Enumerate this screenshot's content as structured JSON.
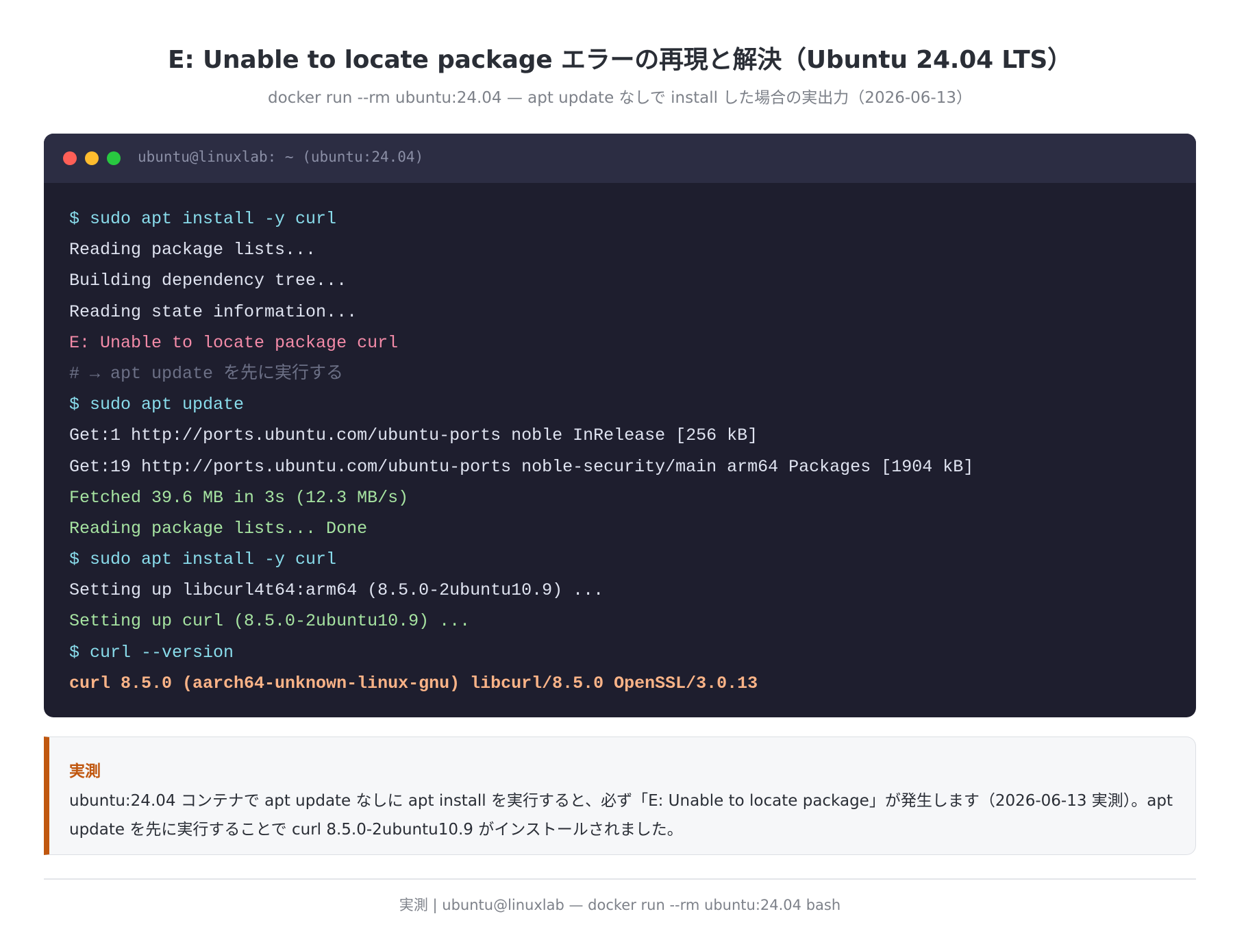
{
  "header": {
    "title": "E: Unable to locate package エラーの再現と解決（Ubuntu 24.04 LTS）",
    "subtitle": "docker run --rm ubuntu:24.04 — apt update なしで install した場合の実出力（2026-06-13）"
  },
  "terminal": {
    "window_title": "ubuntu@linuxlab: ~ (ubuntu:24.04)",
    "window_buttons": [
      "close",
      "minimize",
      "maximize"
    ],
    "colors": {
      "background": "#1e1e2e",
      "titlebar": "#2c2d43",
      "command": "#89dceb",
      "output": "#dfe3f0",
      "error": "#f38ba8",
      "comment": "#6c7086",
      "success": "#a6e3a1",
      "result": "#fab387"
    },
    "lines": [
      {
        "type": "cmd",
        "text": "$ sudo apt install -y curl"
      },
      {
        "type": "out",
        "text": "Reading package lists..."
      },
      {
        "type": "out",
        "text": "Building dependency tree..."
      },
      {
        "type": "out",
        "text": "Reading state information..."
      },
      {
        "type": "err",
        "text": "E: Unable to locate package curl"
      },
      {
        "type": "comment",
        "text": "# → apt update を先に実行する"
      },
      {
        "type": "cmd",
        "text": "$ sudo apt update"
      },
      {
        "type": "out",
        "text": "Get:1 http://ports.ubuntu.com/ubuntu-ports noble InRelease [256 kB]"
      },
      {
        "type": "out",
        "text": "Get:19 http://ports.ubuntu.com/ubuntu-ports noble-security/main arm64 Packages [1904 kB]"
      },
      {
        "type": "ok",
        "text": "Fetched 39.6 MB in 3s (12.3 MB/s)"
      },
      {
        "type": "ok",
        "text": "Reading package lists... Done"
      },
      {
        "type": "cmd",
        "text": "$ sudo apt install -y curl"
      },
      {
        "type": "out",
        "text": "Setting up libcurl4t64:arm64 (8.5.0-2ubuntu10.9) ..."
      },
      {
        "type": "ok",
        "text": "Setting up curl (8.5.0-2ubuntu10.9) ..."
      },
      {
        "type": "cmd",
        "text": "$ curl --version"
      },
      {
        "type": "result",
        "text": "curl 8.5.0 (aarch64-unknown-linux-gnu) libcurl/8.5.0 OpenSSL/3.0.13"
      }
    ]
  },
  "note": {
    "heading": "実測",
    "text": "ubuntu:24.04 コンテナで apt update なしに apt install を実行すると、必ず「E: Unable to locate package」が発生します（2026-06-13 実測）。apt update を先に実行することで curl 8.5.0-2ubuntu10.9 がインストールされました。",
    "accent_color": "#c0570f"
  },
  "footer": {
    "text": "実測 | ubuntu@linuxlab — docker run --rm ubuntu:24.04 bash"
  }
}
